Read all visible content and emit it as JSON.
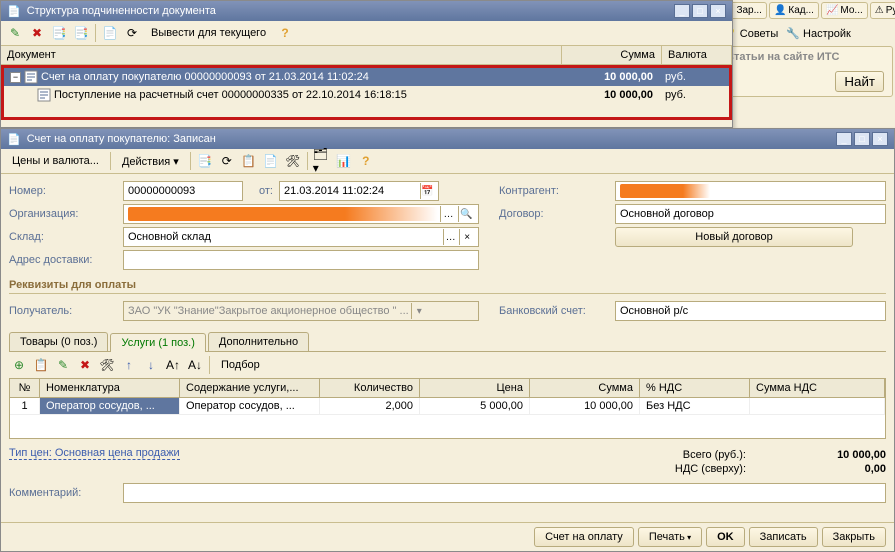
{
  "bg": {
    "tabs": [
      "Зар...",
      "Кад...",
      "Мо...",
      "Рук..."
    ],
    "tb_tips": "Советы",
    "tb_settings": "Настройк",
    "section_title": "Статьи на сайте ИТС",
    "find_btn": "Найт"
  },
  "struct": {
    "title": "Структура подчиненности документа",
    "tb_output": "Вывести для текущего",
    "hdr_doc": "Документ",
    "hdr_sum": "Сумма",
    "hdr_cur": "Валюта",
    "rows": [
      {
        "text": "Счет на оплату покупателю 00000000093 от 21.03.2014 11:02:24",
        "sum": "10 000,00",
        "cur": "руб.",
        "sel": true,
        "level": 0
      },
      {
        "text": "Поступление на расчетный счет 00000000335 от 22.10.2014 16:18:15",
        "sum": "10 000,00",
        "cur": "руб.",
        "sel": false,
        "level": 1
      }
    ]
  },
  "doc": {
    "title": "Счет на оплату покупателю: Записан",
    "tb_prices": "Цены и валюта...",
    "tb_actions": "Действия",
    "lbl_number": "Номер:",
    "val_number": "00000000093",
    "lbl_from": "от:",
    "val_date": "21.03.2014 11:02:24",
    "lbl_org": "Организация:",
    "lbl_store": "Склад:",
    "val_store": "Основной склад",
    "lbl_addr": "Адрес доставки:",
    "lbl_counter": "Контрагент:",
    "lbl_contract": "Договор:",
    "val_contract": "Основной договор",
    "btn_newcontract": "Новый договор",
    "section_pay": "Реквизиты для оплаты",
    "lbl_recipient": "Получатель:",
    "val_recipient": "ЗАО \"УК \"Знание\"Закрытое акционерное общество \" ...",
    "lbl_bank": "Банковский счет:",
    "val_bank": "Основной р/с",
    "tabs": [
      "Товары (0 поз.)",
      "Услуги (1 поз.)",
      "Дополнительно"
    ],
    "active_tab": 1,
    "grid_tb_select": "Подбор",
    "grid": {
      "hdr": {
        "n": "№",
        "nom": "Номенклатура",
        "cont": "Содержание услуги,...",
        "qty": "Количество",
        "price": "Цена",
        "sum": "Сумма",
        "vat": "% НДС",
        "vatsum": "Сумма НДС"
      },
      "row": {
        "n": "1",
        "nom": "Оператор сосудов, ...",
        "cont": "Оператор сосудов, ...",
        "qty": "2,000",
        "price": "5 000,00",
        "sum": "10 000,00",
        "vat": "Без НДС",
        "vatsum": ""
      }
    },
    "pricetype_lbl": "Тип цен: Основная цена продажи",
    "totals_lbl": "Всего (руб.):",
    "totals_val": "10 000,00",
    "vat_lbl": "НДС (сверху):",
    "vat_val": "0,00",
    "lbl_comment": "Комментарий:",
    "btn_invoice": "Счет на оплату",
    "btn_print": "Печать",
    "btn_ok": "OK",
    "btn_save": "Записать",
    "btn_close": "Закрыть"
  }
}
